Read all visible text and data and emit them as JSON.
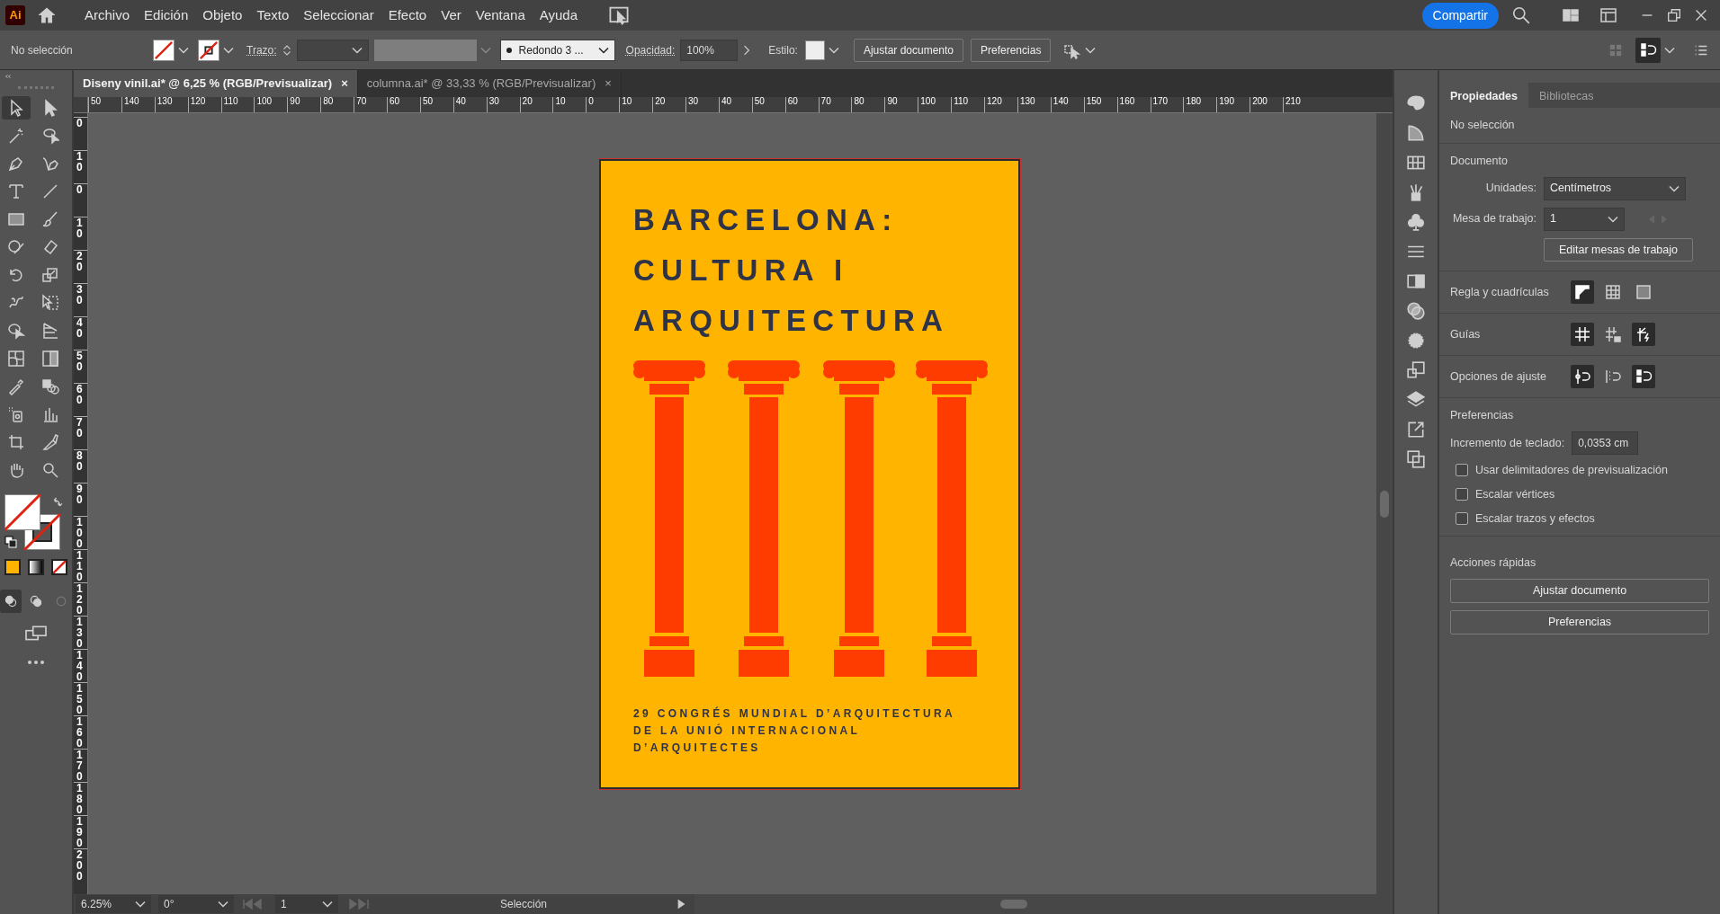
{
  "app": {
    "logo": "Ai"
  },
  "menu": [
    "Archivo",
    "Edición",
    "Objeto",
    "Texto",
    "Seleccionar",
    "Efecto",
    "Ver",
    "Ventana",
    "Ayuda"
  ],
  "share_button": "Compartir",
  "control_bar": {
    "selection": "No selección",
    "stroke_label": "Trazo:",
    "brush": "Redondo 3 ...",
    "opacity_label": "Opacidad:",
    "opacity": "100%",
    "style_label": "Estilo:",
    "buttons": [
      "Ajustar documento",
      "Preferencias"
    ]
  },
  "tabs": [
    {
      "label": "Diseny vinil.ai* @ 6,25 % (RGB/Previsualizar)",
      "close": "×",
      "selected": true
    },
    {
      "label": "columna.ai* @ 33,33 % (RGB/Previsualizar)",
      "close": "×",
      "selected": false
    }
  ],
  "ruler": {
    "horizontal": [
      "50",
      "140",
      "130",
      "120",
      "110",
      "100",
      "90",
      "80",
      "70",
      "60",
      "50",
      "40",
      "30",
      "20",
      "10",
      "0",
      "10",
      "20",
      "30",
      "40",
      "50",
      "60",
      "70",
      "80",
      "90",
      "100",
      "110",
      "120",
      "130",
      "140",
      "150",
      "160",
      "170",
      "180",
      "190",
      "200",
      "210"
    ],
    "vertical": [
      "0",
      "10",
      "0",
      "10",
      "20",
      "30",
      "40",
      "50",
      "60",
      "70",
      "80",
      "90",
      "100",
      "110",
      "120",
      "130",
      "140",
      "150",
      "160",
      "170",
      "180",
      "190",
      "200"
    ]
  },
  "artboard": {
    "title_lines": [
      "BARCELONA:",
      "CULTURA I",
      "ARQUITECTURA"
    ],
    "subtitle_lines": [
      "29 CONGRÉS MUNDIAL D’ARQUITECTURA",
      "DE LA UNIÓ INTERNACIONAL",
      "D’ARQUITECTES"
    ]
  },
  "panel": {
    "tabs": [
      {
        "label": "Propiedades",
        "selected": true
      },
      {
        "label": "Bibliotecas",
        "selected": false
      }
    ],
    "selection": "No selección",
    "document": {
      "heading": "Documento",
      "units_label": "Unidades:",
      "units": "Centímetros",
      "artboard_label": "Mesa de trabajo:",
      "artboard": "1",
      "edit_button": "Editar mesas de trabajo"
    },
    "rulers_grids": {
      "label": "Regla y cuadrículas",
      "toggles": [
        {
          "selected": true
        },
        {
          "selected": false
        },
        {
          "selected": false
        }
      ]
    },
    "guides": {
      "label": "Guías",
      "toggles": [
        {
          "selected": true
        },
        {
          "selected": false
        },
        {
          "selected": true
        }
      ]
    },
    "snap": {
      "label": "Opciones de ajuste",
      "toggles": [
        {
          "selected": true
        },
        {
          "selected": false
        },
        {
          "selected": true
        }
      ]
    },
    "preferences": {
      "heading": "Preferencias",
      "nudge_label": "Incremento de teclado:",
      "nudge": "0,0353 cm",
      "checkboxes": [
        {
          "label": "Usar delimitadores de previsualización",
          "checked": false
        },
        {
          "label": "Escalar vértices",
          "checked": false
        },
        {
          "label": "Escalar trazos y efectos",
          "checked": false
        }
      ]
    },
    "quick_actions": {
      "heading": "Acciones rápidas",
      "buttons": [
        "Ajustar documento",
        "Preferencias"
      ]
    }
  },
  "status_bar": {
    "zoom": "6.25%",
    "rotation": "0°",
    "artboard": "1",
    "tool": "Selección"
  }
}
